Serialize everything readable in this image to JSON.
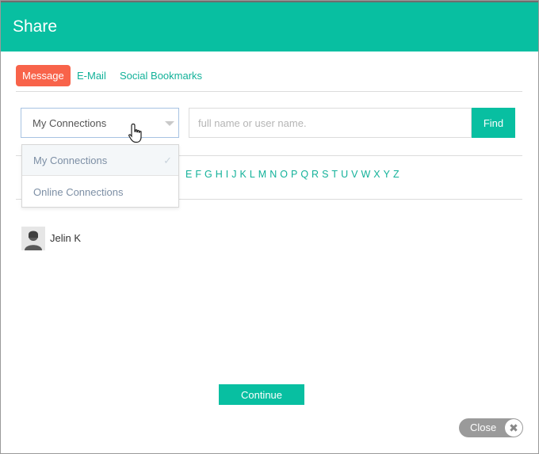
{
  "dialog": {
    "title": "Share"
  },
  "tabs": [
    {
      "label": "Message",
      "active": true
    },
    {
      "label": "E-Mail",
      "active": false
    },
    {
      "label": "Social Bookmarks",
      "active": false
    }
  ],
  "filter": {
    "selected": "My Connections",
    "options": [
      "My Connections",
      "Online Connections"
    ],
    "checked_icon": "checkmark-icon"
  },
  "search": {
    "placeholder": "full name or user name.",
    "value": "",
    "button_label": "Find"
  },
  "alphabet": [
    "E",
    "F",
    "G",
    "H",
    "I",
    "J",
    "K",
    "L",
    "M",
    "N",
    "O",
    "P",
    "Q",
    "R",
    "S",
    "T",
    "U",
    "V",
    "W",
    "X",
    "Y",
    "Z"
  ],
  "contacts": [
    {
      "name": "Jelin K",
      "avatar_icon": "default-user-icon"
    }
  ],
  "footer": {
    "continue_label": "Continue",
    "close_label": "Close",
    "close_icon": "close-icon"
  },
  "colors": {
    "header": "#08bfa1",
    "active_tab": "#f8634a",
    "link": "#12b199",
    "close_button": "#9a9a9a"
  }
}
